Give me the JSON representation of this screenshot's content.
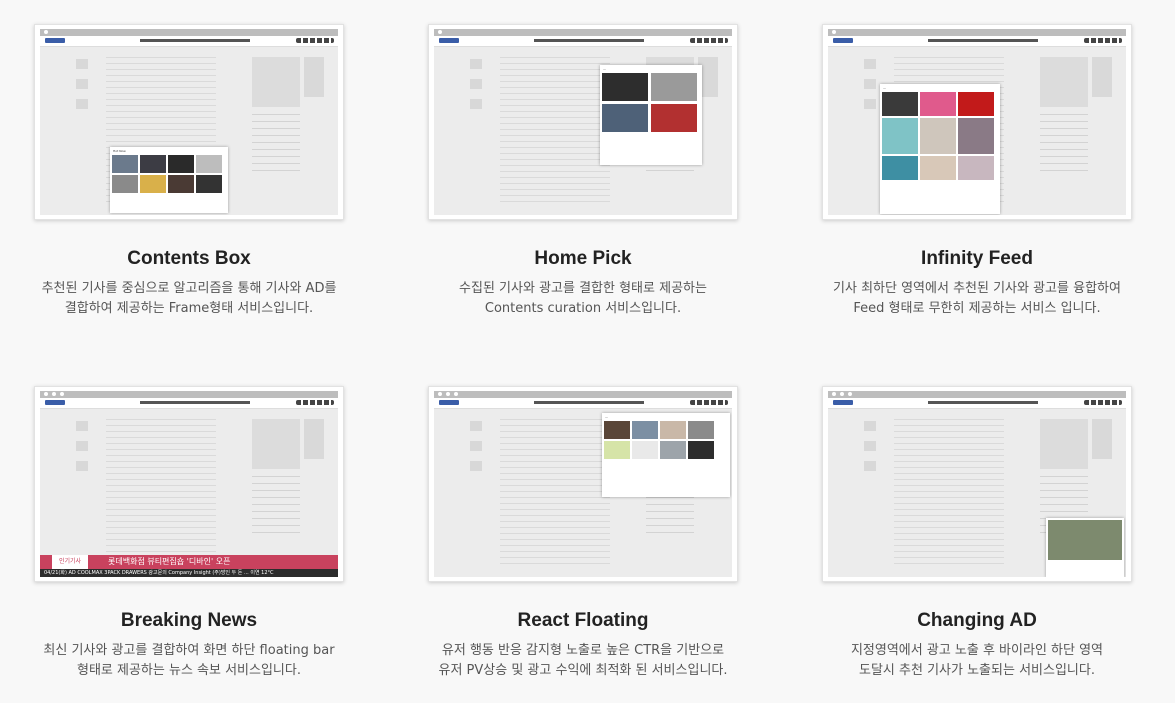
{
  "services": [
    {
      "key": "contents-box",
      "title": "Contents Box",
      "desc": "추천된 기사를 중심으로 알고리즘을 통해 기사와 AD를\n결합하여 제공하는 Frame형태 서비스입니다."
    },
    {
      "key": "home-pick",
      "title": "Home Pick",
      "desc": "수집된 기사와 광고를 결합한 형태로 제공하는\nContents curation 서비스입니다."
    },
    {
      "key": "infinity-feed",
      "title": "Infinity Feed",
      "desc": "기사 최하단 영역에서 추천된 기사와 광고를 융합하여\nFeed 형태로 무한히 제공하는 서비스 입니다."
    },
    {
      "key": "breaking-news",
      "title": "Breaking News",
      "desc": "최신 기사와 광고를 결합하여 화면 하단 floating bar\n형태로 제공하는 뉴스 속보 서비스입니다.",
      "bar_tag": "인기기사",
      "bar_text": "롯데백화점 뷰티편집숍 '디바인' 오픈",
      "ticker": "04/21(화)  AD  COOLMAX 3PACK DRAWERS      광고문의  Company Insight (주)방인 두 돈 ...   이연   12°C"
    },
    {
      "key": "react-floating",
      "title": "React Floating",
      "desc": "유저 행동 반응 감지형 노출로 높은 CTR을 기반으로\n유저 PV상승 및 광고 수익에 최적화 된 서비스입니다."
    },
    {
      "key": "changing-ad",
      "title": "Changing AD",
      "desc": "지정영역에서 광고 노출 후 바이라인 하단 영역\n도달시 추천 기사가 노출되는 서비스입니다."
    }
  ]
}
